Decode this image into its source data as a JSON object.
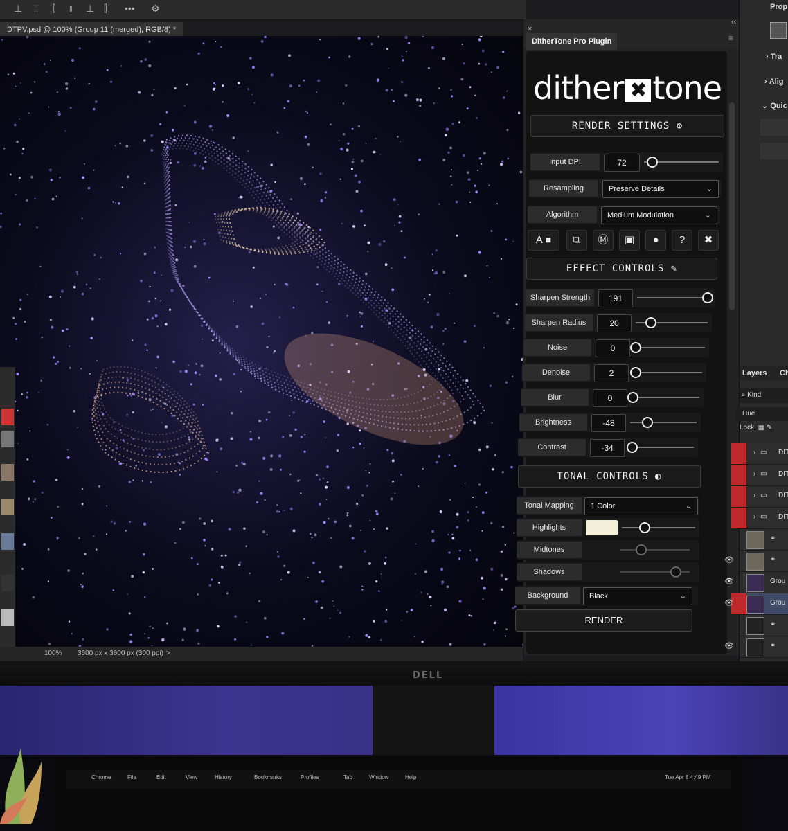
{
  "photoshop": {
    "document_tab": "DTPV.psd @ 100% (Group 11 (merged), RGB/8) *",
    "status_zoom": "100%",
    "status_size": "3600 px x 3600 px (300 ppi)",
    "status_arrow": ">"
  },
  "plugin": {
    "close": "×",
    "collapse": "‹‹",
    "menu": "≡",
    "tab_title": "DitherTone Pro Plugin",
    "logo_left": "dither",
    "logo_right": "tone",
    "render_settings_label": "RENDER SETTINGS",
    "input_dpi": {
      "label": "Input DPI",
      "value": "72",
      "slider": 0.1
    },
    "resampling": {
      "label": "Resampling",
      "value": "Preserve Details"
    },
    "algorithm": {
      "label": "Algorithm",
      "value": "Medium Modulation"
    },
    "tool_icons": [
      "text-color-icon",
      "transform-icon",
      "mode-icon",
      "save-icon",
      "ink-icon",
      "help-icon",
      "reset-icon"
    ],
    "effect_controls_label": "EFFECT CONTROLS",
    "effects": [
      {
        "label": "Sharpen Strength",
        "value": "191",
        "slider": 1.0
      },
      {
        "label": "Sharpen Radius",
        "value": "20",
        "slider": 0.2
      },
      {
        "label": "Noise",
        "value": "0",
        "slider": 0.0
      },
      {
        "label": "Denoise",
        "value": "2",
        "slider": 0.02
      },
      {
        "label": "Blur",
        "value": "0",
        "slider": 0.0
      },
      {
        "label": "Brightness",
        "value": "-48",
        "slider": 0.26
      },
      {
        "label": "Contrast",
        "value": "-34",
        "slider": 0.03
      }
    ],
    "tonal_controls_label": "TONAL CONTROLS",
    "tonal_mapping": {
      "label": "Tonal Mapping",
      "value": "1 Color"
    },
    "highlights": {
      "label": "Highlights",
      "color": "#f3efd8",
      "slider": 0.32
    },
    "midtones": {
      "label": "Midtones",
      "slider": 0.3
    },
    "shadows": {
      "label": "Shadows",
      "slider": 0.85
    },
    "background": {
      "label": "Background",
      "value": "Black"
    },
    "render_button": "RENDER"
  },
  "right_panel": {
    "properties_label": "Prop",
    "transform_label": "Tra",
    "align_label": "Alig",
    "quick_label": "Quic",
    "layers_tab": "Layers",
    "channels_tab": "Ch",
    "filter_kind": "Kind",
    "blend_mode": "Hue",
    "lock_label": "Lock:",
    "layers": [
      {
        "name": "DIT",
        "type": "folder"
      },
      {
        "name": "DIT",
        "type": "folder"
      },
      {
        "name": "DIT",
        "type": "folder"
      },
      {
        "name": "DIT",
        "type": "folder"
      },
      {
        "name": "",
        "type": "layer"
      },
      {
        "name": "",
        "type": "layer"
      },
      {
        "name": "Grou",
        "type": "layer"
      },
      {
        "name": "Grou",
        "type": "layer"
      },
      {
        "name": "",
        "type": "adjustment"
      },
      {
        "name": "",
        "type": "adjustment"
      }
    ]
  },
  "monitor_brand": "DELL",
  "mac_menu": [
    "Chrome",
    "File",
    "Edit",
    "View",
    "History",
    "Bookmarks",
    "Profiles",
    "Tab",
    "Window",
    "Help"
  ],
  "mac_clock": "Tue Apr 8  4:49 PM",
  "colors": {
    "plugin_bg": "#121212",
    "selected_layer": "#c0282b",
    "canvas_glow": "#b49cff"
  }
}
